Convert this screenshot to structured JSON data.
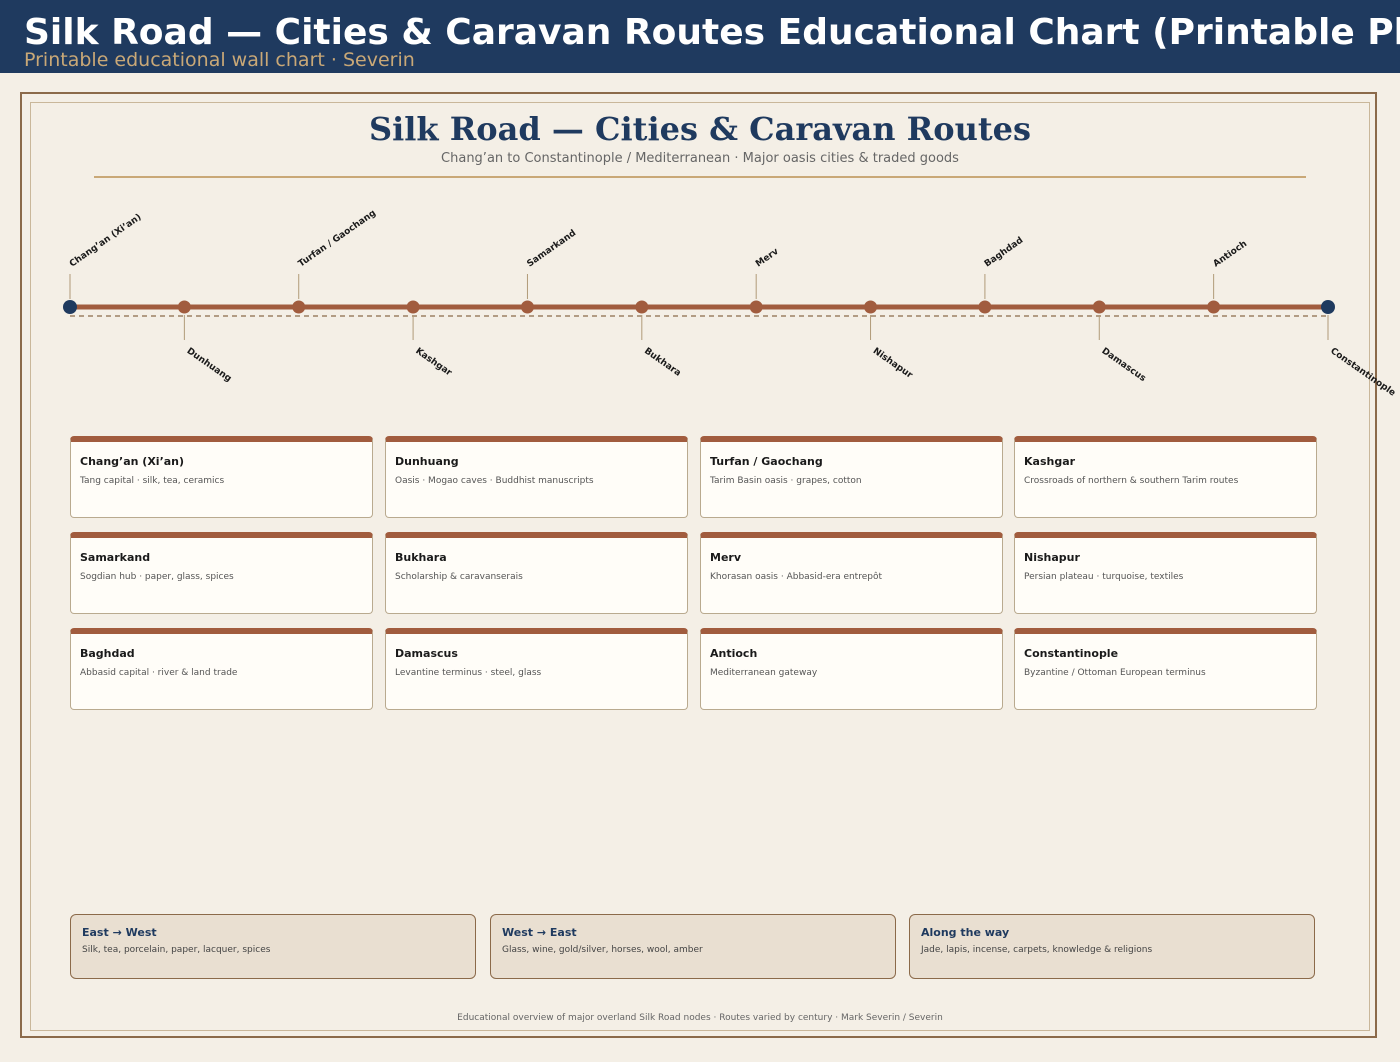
{
  "header": {
    "title": "Silk Road — Cities & Caravan Routes Educational Chart (Printable Pl",
    "subtitle": "Printable educational wall chart  ·  Severin"
  },
  "chart": {
    "title": "Silk Road — Cities & Caravan Routes",
    "subtitle": "Chang’an to Constantinople / Mediterranean  ·  Major oasis cities & traded goods"
  },
  "colors": {
    "navy": "#1f3a5f",
    "route": "#a15c3e",
    "gold": "#c9a877",
    "paper": "#f4efe6"
  },
  "cities": [
    {
      "name": "Chang’an (Xi’an)",
      "desc": "Tang capital · silk, tea, ceramics"
    },
    {
      "name": "Dunhuang",
      "desc": "Oasis · Mogao caves · Buddhist manuscripts"
    },
    {
      "name": "Turfan / Gaochang",
      "desc": "Tarim Basin oasis · grapes, cotton"
    },
    {
      "name": "Kashgar",
      "desc": "Crossroads of northern & southern Tarim routes"
    },
    {
      "name": "Samarkand",
      "desc": "Sogdian hub · paper, glass, spices"
    },
    {
      "name": "Bukhara",
      "desc": "Scholarship & caravanserais"
    },
    {
      "name": "Merv",
      "desc": "Khorasan oasis · Abbasid-era entrepôt"
    },
    {
      "name": "Nishapur",
      "desc": "Persian plateau · turquoise, textiles"
    },
    {
      "name": "Baghdad",
      "desc": "Abbasid capital · river & land trade"
    },
    {
      "name": "Damascus",
      "desc": "Levantine terminus · steel, glass"
    },
    {
      "name": "Antioch",
      "desc": "Mediterranean gateway"
    },
    {
      "name": "Constantinople",
      "desc": "Byzantine / Ottoman European terminus"
    }
  ],
  "panels": [
    {
      "title": "East → West",
      "text": "Silk, tea, porcelain, paper, lacquer, spices"
    },
    {
      "title": "West → East",
      "text": "Glass, wine, gold/silver, horses, wool, amber"
    },
    {
      "title": "Along the way",
      "text": "Jade, lapis, incense, carpets, knowledge & religions"
    }
  ],
  "footer": "Educational overview of major overland Silk Road nodes · Routes varied by century · Mark Severin / Severin"
}
